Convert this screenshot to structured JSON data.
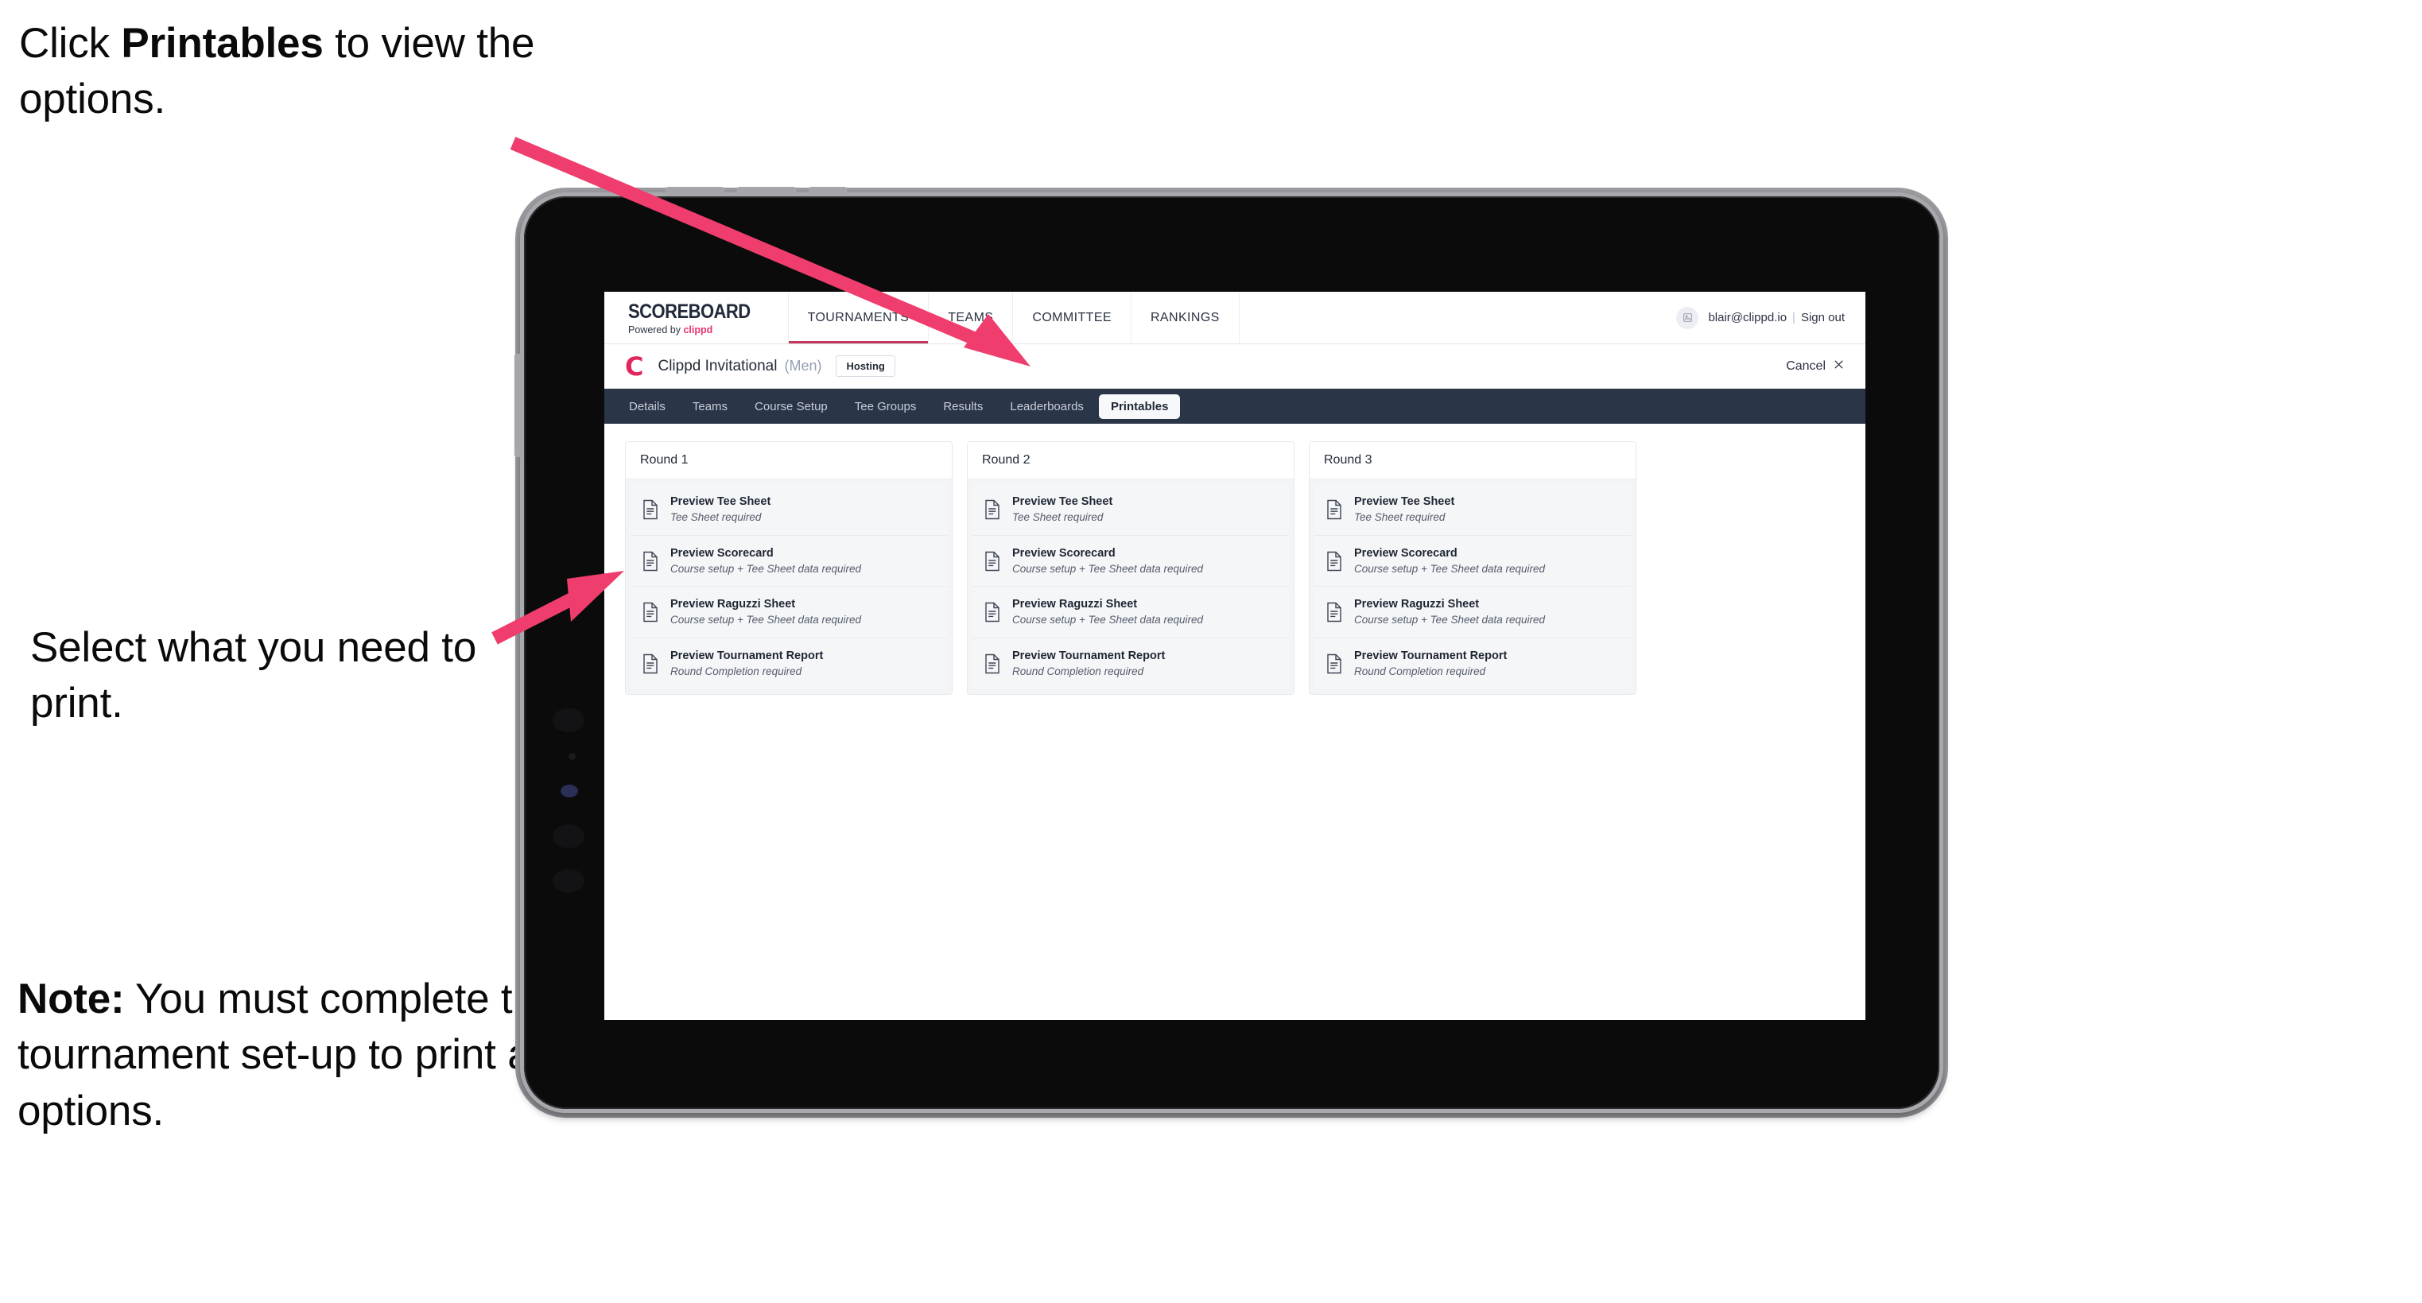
{
  "annotations": [
    {
      "id": "a1",
      "before": "Click ",
      "bold": "Printables",
      "after": " to view the options."
    },
    {
      "id": "a2",
      "before": "Select what you need to print.",
      "bold": "",
      "after": ""
    },
    {
      "id": "a3",
      "before": "",
      "bold": "Note:",
      "after": " You must complete the tournament set-up to print all the options."
    }
  ],
  "colors": {
    "accent_pink": "#ef3e6d",
    "navbar_dark": "#2b3548",
    "brand_red": "#e0265c",
    "tab_underline": "#c2395c"
  },
  "appbar": {
    "brand_title": "SCOREBOARD",
    "brand_sub_prefix": "Powered by ",
    "brand_sub_name": "clippd",
    "nav": [
      {
        "label": "TOURNAMENTS",
        "active": true
      },
      {
        "label": "TEAMS",
        "active": false
      },
      {
        "label": "COMMITTEE",
        "active": false
      },
      {
        "label": "RANKINGS",
        "active": false
      }
    ],
    "avatar_icon": "user-avatar-icon",
    "account_email": "blair@clippd.io",
    "separator": "|",
    "sign_out": "Sign out"
  },
  "tournament_bar": {
    "logo_letter": "C",
    "name": "Clippd Invitational",
    "gender": "(Men)",
    "badge": "Hosting",
    "cancel_label": "Cancel",
    "cancel_icon": "close-icon"
  },
  "tabs": [
    {
      "label": "Details",
      "active": false
    },
    {
      "label": "Teams",
      "active": false
    },
    {
      "label": "Course Setup",
      "active": false
    },
    {
      "label": "Tee Groups",
      "active": false
    },
    {
      "label": "Results",
      "active": false
    },
    {
      "label": "Leaderboards",
      "active": false
    },
    {
      "label": "Printables",
      "active": true
    }
  ],
  "rounds": [
    {
      "title": "Round 1",
      "items": [
        {
          "title": "Preview Tee Sheet",
          "sub": "Tee Sheet required",
          "icon": "document-icon"
        },
        {
          "title": "Preview Scorecard",
          "sub": "Course setup + Tee Sheet data required",
          "icon": "document-icon"
        },
        {
          "title": "Preview Raguzzi Sheet",
          "sub": "Course setup + Tee Sheet data required",
          "icon": "document-icon"
        },
        {
          "title": "Preview Tournament Report",
          "sub": "Round Completion required",
          "icon": "document-icon"
        }
      ]
    },
    {
      "title": "Round 2",
      "items": [
        {
          "title": "Preview Tee Sheet",
          "sub": "Tee Sheet required",
          "icon": "document-icon"
        },
        {
          "title": "Preview Scorecard",
          "sub": "Course setup + Tee Sheet data required",
          "icon": "document-icon"
        },
        {
          "title": "Preview Raguzzi Sheet",
          "sub": "Course setup + Tee Sheet data required",
          "icon": "document-icon"
        },
        {
          "title": "Preview Tournament Report",
          "sub": "Round Completion required",
          "icon": "document-icon"
        }
      ]
    },
    {
      "title": "Round 3",
      "items": [
        {
          "title": "Preview Tee Sheet",
          "sub": "Tee Sheet required",
          "icon": "document-icon"
        },
        {
          "title": "Preview Scorecard",
          "sub": "Course setup + Tee Sheet data required",
          "icon": "document-icon"
        },
        {
          "title": "Preview Raguzzi Sheet",
          "sub": "Course setup + Tee Sheet data required",
          "icon": "document-icon"
        },
        {
          "title": "Preview Tournament Report",
          "sub": "Round Completion required",
          "icon": "document-icon"
        }
      ]
    }
  ]
}
